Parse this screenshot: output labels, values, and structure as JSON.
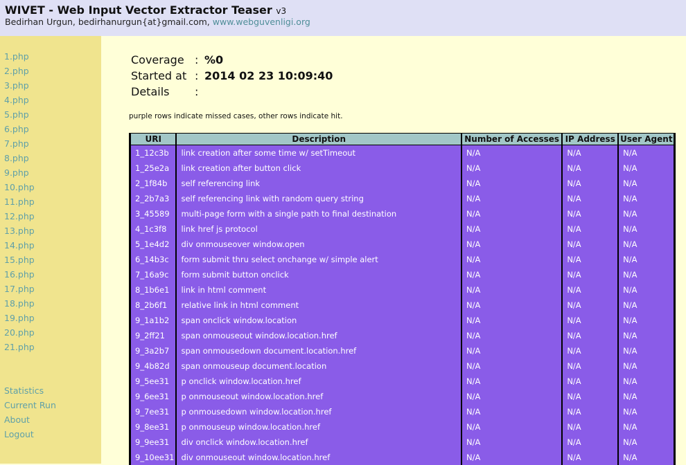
{
  "header": {
    "title": "WIVET - Web Input Vector Extractor Teaser",
    "version": "v3",
    "author": "Bedirhan Urgun, bedirhanurgun{at}gmail.com,",
    "site": "www.webguvenligi.org"
  },
  "sidebar": {
    "pages": [
      "1.php",
      "2.php",
      "3.php",
      "4.php",
      "5.php",
      "6.php",
      "7.php",
      "8.php",
      "9.php",
      "10.php",
      "11.php",
      "12.php",
      "13.php",
      "14.php",
      "15.php",
      "16.php",
      "17.php",
      "18.php",
      "19.php",
      "20.php",
      "21.php"
    ],
    "links": [
      "Statistics",
      "Current Run",
      "About",
      "Logout"
    ]
  },
  "summary": {
    "coverage_label": "Coverage",
    "coverage_value": "%0",
    "started_label": "Started at",
    "started_value": "2014 02 23 10:09:40",
    "details_label": "Details",
    "separator": ":"
  },
  "note": "purple rows indicate missed cases, other rows indicate hit.",
  "table": {
    "headers": [
      "URI",
      "Description",
      "Number of Accesses",
      "IP Address",
      "User Agent"
    ],
    "rows": [
      [
        "1_12c3b",
        "link creation after some time w/ setTimeout",
        "N/A",
        "N/A",
        "N/A"
      ],
      [
        "1_25e2a",
        "link creation after button click",
        "N/A",
        "N/A",
        "N/A"
      ],
      [
        "2_1f84b",
        "self referencing link",
        "N/A",
        "N/A",
        "N/A"
      ],
      [
        "2_2b7a3",
        "self referencing link with random query string",
        "N/A",
        "N/A",
        "N/A"
      ],
      [
        "3_45589",
        "multi-page form with a single path to final destination",
        "N/A",
        "N/A",
        "N/A"
      ],
      [
        "4_1c3f8",
        "link href js protocol",
        "N/A",
        "N/A",
        "N/A"
      ],
      [
        "5_1e4d2",
        "div onmouseover window.open",
        "N/A",
        "N/A",
        "N/A"
      ],
      [
        "6_14b3c",
        "form submit thru select onchange w/ simple alert",
        "N/A",
        "N/A",
        "N/A"
      ],
      [
        "7_16a9c",
        "form submit button onclick",
        "N/A",
        "N/A",
        "N/A"
      ],
      [
        "8_1b6e1",
        "link in html comment",
        "N/A",
        "N/A",
        "N/A"
      ],
      [
        "8_2b6f1",
        "relative link in html comment",
        "N/A",
        "N/A",
        "N/A"
      ],
      [
        "9_1a1b2",
        "span onclick window.location",
        "N/A",
        "N/A",
        "N/A"
      ],
      [
        "9_2ff21",
        "span onmouseout window.location.href",
        "N/A",
        "N/A",
        "N/A"
      ],
      [
        "9_3a2b7",
        "span onmousedown document.location.href",
        "N/A",
        "N/A",
        "N/A"
      ],
      [
        "9_4b82d",
        "span onmouseup document.location",
        "N/A",
        "N/A",
        "N/A"
      ],
      [
        "9_5ee31",
        "p onclick window.location.href",
        "N/A",
        "N/A",
        "N/A"
      ],
      [
        "9_6ee31",
        "p onmouseout window.location.href",
        "N/A",
        "N/A",
        "N/A"
      ],
      [
        "9_7ee31",
        "p onmousedown window.location.href",
        "N/A",
        "N/A",
        "N/A"
      ],
      [
        "9_8ee31",
        "p onmouseup window.location.href",
        "N/A",
        "N/A",
        "N/A"
      ],
      [
        "9_9ee31",
        "div onclick window.location.href",
        "N/A",
        "N/A",
        "N/A"
      ],
      [
        "9_10ee31",
        "div onmouseout window.location.href",
        "N/A",
        "N/A",
        "N/A"
      ]
    ]
  },
  "colors": {
    "header_bg": "#dfe0f5",
    "sidebar_bg": "#f0e48e",
    "main_bg": "#ffffd8",
    "link": "#5fa0a8",
    "missed_row": "#8a5ce8",
    "table_header": "#a2c7c7"
  }
}
